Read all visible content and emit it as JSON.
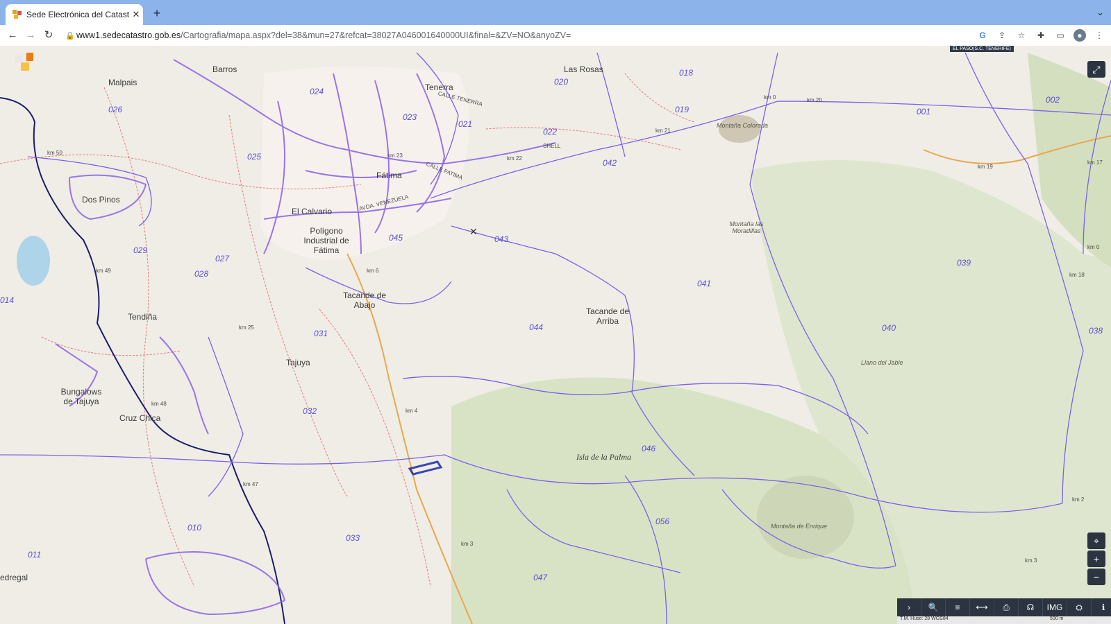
{
  "browser": {
    "tab_title": "Sede Electrónica del Catastro",
    "url_host": "www1.sedecatastro.gob.es",
    "url_path": "/Cartografia/mapa.aspx?del=38&mun=27&refcat=38027A046001640000UI&final=&ZV=NO&anyoZV="
  },
  "map": {
    "banner": "EL PASO(S.C. TENERIFE)",
    "place_names": [
      {
        "text": "Barros"
      },
      {
        "text": "Malpais"
      },
      {
        "text": "Las Rosas"
      },
      {
        "text": "Tenerra"
      },
      {
        "text": "Fátima"
      },
      {
        "text": "Dos Pinos"
      },
      {
        "text": "El Calvario"
      },
      {
        "text": "Polígono Industrial de Fátima"
      },
      {
        "text": "Tacande de Abajo"
      },
      {
        "text": "Tacande de Arriba"
      },
      {
        "text": "Tendiña"
      },
      {
        "text": "Tajuya"
      },
      {
        "text": "Bungalows de Tajuya"
      },
      {
        "text": "Cruz Chica"
      },
      {
        "text": "edregal"
      }
    ],
    "parcels": [
      "018",
      "020",
      "024",
      "023",
      "021",
      "026",
      "019",
      "001",
      "002",
      "022",
      "025",
      "042",
      "045",
      "043",
      "029",
      "027",
      "028",
      "014",
      "041",
      "039",
      "031",
      "044",
      "040",
      "038",
      "032",
      "046",
      "056",
      "010",
      "033",
      "011",
      "047"
    ],
    "street_names": [
      "CALLE TENERRA",
      "AVDA. VENEZUELA",
      "CALLE FATIMA",
      "SHELL"
    ],
    "terrain_names": [
      "Montaña Colorada",
      "Montaña las Moradillas",
      "Llano del Jable",
      "Montaña de Enrique"
    ],
    "island_name": "Isla de la Palma",
    "km_marks": [
      "km 0",
      "km 20",
      "km 21",
      "km 50",
      "km 23",
      "km 22",
      "km 19",
      "km 17",
      "km 0",
      "km 49",
      "km 18",
      "km 25",
      "km 48",
      "km 47",
      "km 4",
      "km 3",
      "km 2",
      "km 3",
      "km 6"
    ],
    "scale_text": "500 m",
    "projection_text": "T.M. Huso: 28 WGS84"
  },
  "controls": {
    "bottom": [
      "›",
      "🔍",
      "≡",
      "⟷",
      "⎙",
      "☊",
      "IMG",
      "⛭",
      "ℹ"
    ],
    "side": [
      "⌖",
      "+",
      "−"
    ],
    "fullscreen": "⤢"
  }
}
